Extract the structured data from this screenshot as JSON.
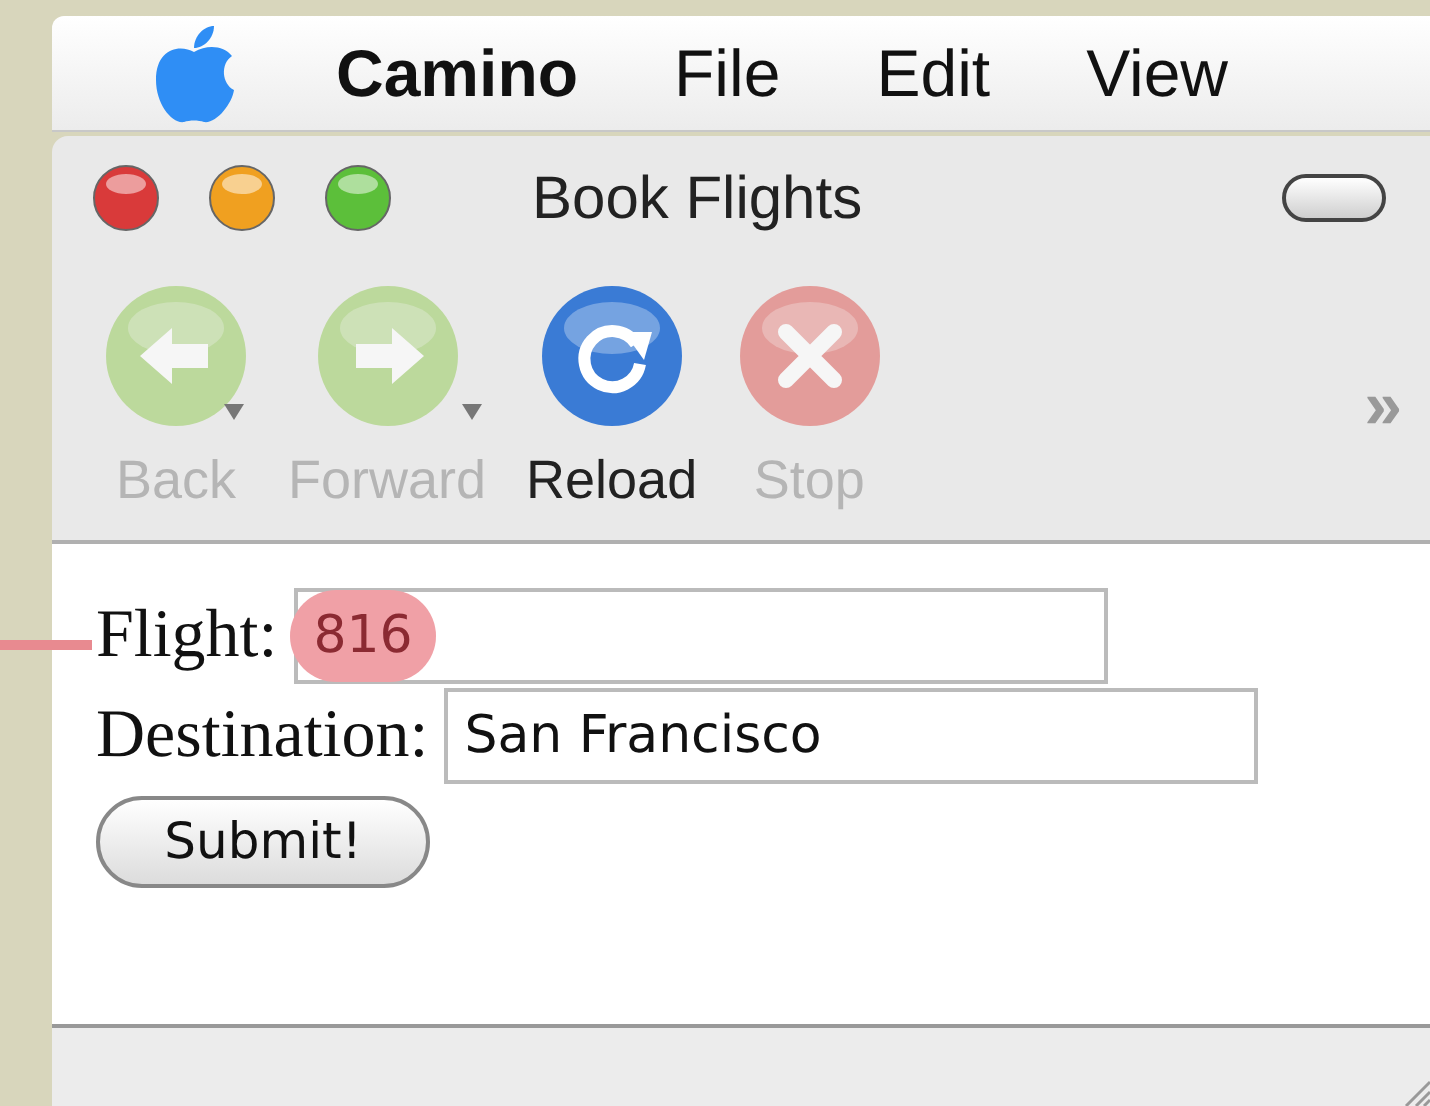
{
  "menu_bar": {
    "items": [
      {
        "label": "Camino",
        "kind": "app"
      },
      {
        "label": "File",
        "kind": "menu"
      },
      {
        "label": "Edit",
        "kind": "menu"
      },
      {
        "label": "View",
        "kind": "menu"
      }
    ]
  },
  "window": {
    "title": "Book Flights"
  },
  "toolbar": {
    "buttons": [
      {
        "label": "Back",
        "kind": "back",
        "disabled": true,
        "has_menu": true
      },
      {
        "label": "Forward",
        "kind": "forward",
        "disabled": true,
        "has_menu": true
      },
      {
        "label": "Reload",
        "kind": "reload",
        "disabled": false,
        "has_menu": false
      },
      {
        "label": "Stop",
        "kind": "stop",
        "disabled": true,
        "has_menu": false
      }
    ],
    "overflow": "»"
  },
  "form": {
    "fields": [
      {
        "label": "Flight:",
        "value": "816",
        "highlighted": true
      },
      {
        "label": "Destination:",
        "value": "San Francisco",
        "highlighted": false
      }
    ],
    "submit": "Submit!"
  }
}
